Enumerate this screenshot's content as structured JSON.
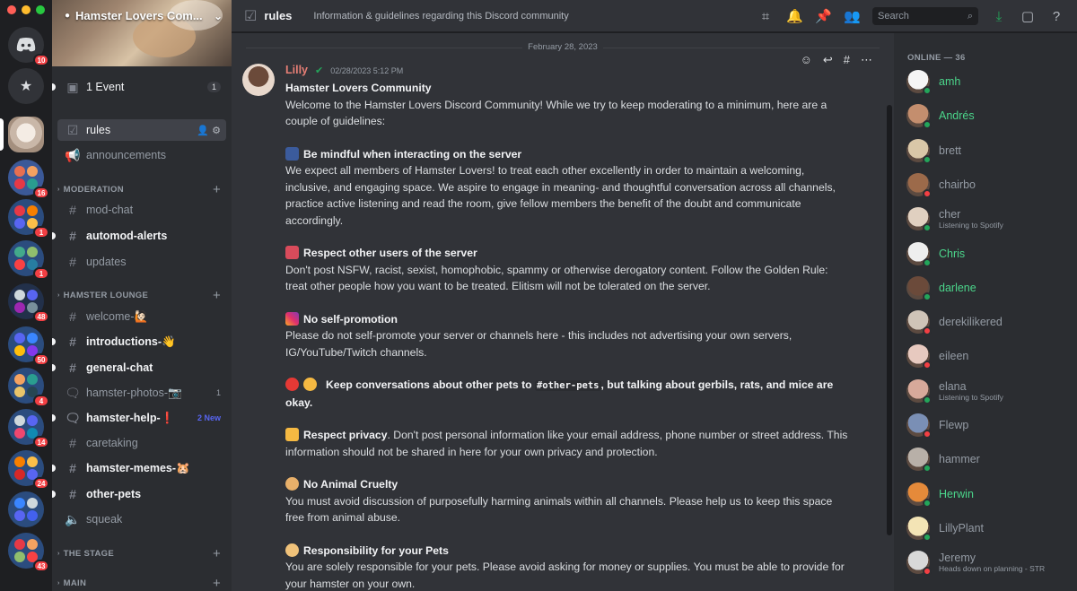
{
  "colors": {
    "accent": "#5865f2",
    "danger": "#f23f43",
    "online": "#23a55a",
    "dnd": "#f23f43",
    "idle": "#f0b232"
  },
  "rail": {
    "home_badge": "10",
    "servers": [
      {
        "badge": "16"
      },
      {
        "badge": "1"
      },
      {
        "badge": "1"
      },
      {
        "badge": "48"
      },
      {
        "badge": "50"
      },
      {
        "badge": "4"
      },
      {
        "badge": "14"
      },
      {
        "badge": "24"
      },
      {
        "badge": ""
      },
      {
        "badge": "43"
      }
    ]
  },
  "sidebar": {
    "server_name": "Hamster Lovers Com...",
    "event": {
      "label": "1 Event",
      "count": "1"
    },
    "channels_top": [
      {
        "label": "rules"
      },
      {
        "label": "announcements"
      }
    ],
    "categories": {
      "moderation": "MODERATION",
      "hamster_lounge": "HAMSTER LOUNGE",
      "the_stage": "THE STAGE",
      "main": "MAIN"
    },
    "moderation": [
      {
        "label": "mod-chat"
      },
      {
        "label": "automod-alerts"
      },
      {
        "label": "updates"
      }
    ],
    "lounge": [
      {
        "label": "welcome-🙋🏻"
      },
      {
        "label": "introductions-👋"
      },
      {
        "label": "general-chat"
      },
      {
        "label": "hamster-photos-📷",
        "count": "1"
      },
      {
        "label": "hamster-help-❗",
        "badge": "2 New"
      },
      {
        "label": "caretaking"
      },
      {
        "label": "hamster-memes-🐹"
      },
      {
        "label": "other-pets"
      },
      {
        "label": "squeak"
      }
    ]
  },
  "header": {
    "channel": "rules",
    "topic": "Information & guidelines regarding this Discord community",
    "search_placeholder": "Search"
  },
  "chat": {
    "date_divider": "February 28, 2023",
    "message": {
      "author": "Lilly",
      "timestamp": "02/28/2023 5:12 PM",
      "title": "Hamster Lovers Community",
      "intro": "Welcome to the Hamster Lovers Discord Community! While we try to keep moderating to a minimum, here are a couple of guidelines:",
      "rules": [
        {
          "heading": "Be mindful when interacting on the server",
          "text": "We expect all members of Hamster Lovers! to treat each other excellently in order to maintain a welcoming, inclusive, and engaging space. We aspire to engage in meaning- and thoughtful conversation across all channels, practice active listening and read the room, give fellow members the benefit of the doubt and communicate accordingly."
        },
        {
          "heading": "Respect other users of the server",
          "text": "Don't post NSFW, racist, sexist, homophobic, spammy or otherwise derogatory content. Follow the Golden Rule: treat other people how you want to be treated. Elitism will not be tolerated on the server."
        },
        {
          "heading": "No self-promotion",
          "text": "Please do not self-promote your server or channels here - this includes not advertising your own servers, IG/YouTube/Twitch channels."
        },
        {
          "heading_a": "Keep conversations about other pets to ",
          "heading_code": "#other-pets",
          "heading_b": ", but talking about gerbils, rats, and mice are okay."
        },
        {
          "heading": "Respect privacy",
          "text": ". Don't post personal information like your email address, phone number or street address. This information should not be shared in here for your own privacy and protection."
        },
        {
          "heading": "No Animal Cruelty",
          "text": "You must avoid discussion of purposefully harming animals within all channels. Please help us to keep this space free from animal abuse."
        },
        {
          "heading": "Responsibility for your Pets",
          "text": "You are solely responsible for your pets. Please avoid asking for money or supplies. You must be able to provide for your hamster on your own."
        }
      ]
    }
  },
  "members": {
    "heading": "ONLINE — 36",
    "list": [
      {
        "name": "amh",
        "sub": "",
        "green": true,
        "status": "online"
      },
      {
        "name": "Andrés",
        "sub": "",
        "green": true,
        "status": "online"
      },
      {
        "name": "brett",
        "sub": "",
        "green": false,
        "status": "online"
      },
      {
        "name": "chairbo",
        "sub": "",
        "green": false,
        "status": "dnd"
      },
      {
        "name": "cher",
        "sub": "Listening to Spotify",
        "green": false,
        "status": "online"
      },
      {
        "name": "Chris",
        "sub": "",
        "green": true,
        "status": "online"
      },
      {
        "name": "darlene",
        "sub": "",
        "green": true,
        "status": "online"
      },
      {
        "name": "derekilikered",
        "sub": "",
        "green": false,
        "status": "dnd"
      },
      {
        "name": "eileen",
        "sub": "",
        "green": false,
        "status": "dnd"
      },
      {
        "name": "elana",
        "sub": "Listening to Spotify",
        "green": false,
        "status": "online"
      },
      {
        "name": "Flewp",
        "sub": "",
        "green": false,
        "status": "dnd"
      },
      {
        "name": "hammer",
        "sub": "",
        "green": false,
        "status": "online"
      },
      {
        "name": "Herwin",
        "sub": "",
        "green": true,
        "status": "online"
      },
      {
        "name": "LillyPlant",
        "sub": "",
        "green": false,
        "status": "online"
      },
      {
        "name": "Jeremy",
        "sub": "Heads down on planning - STR",
        "green": false,
        "status": "dnd"
      }
    ]
  }
}
